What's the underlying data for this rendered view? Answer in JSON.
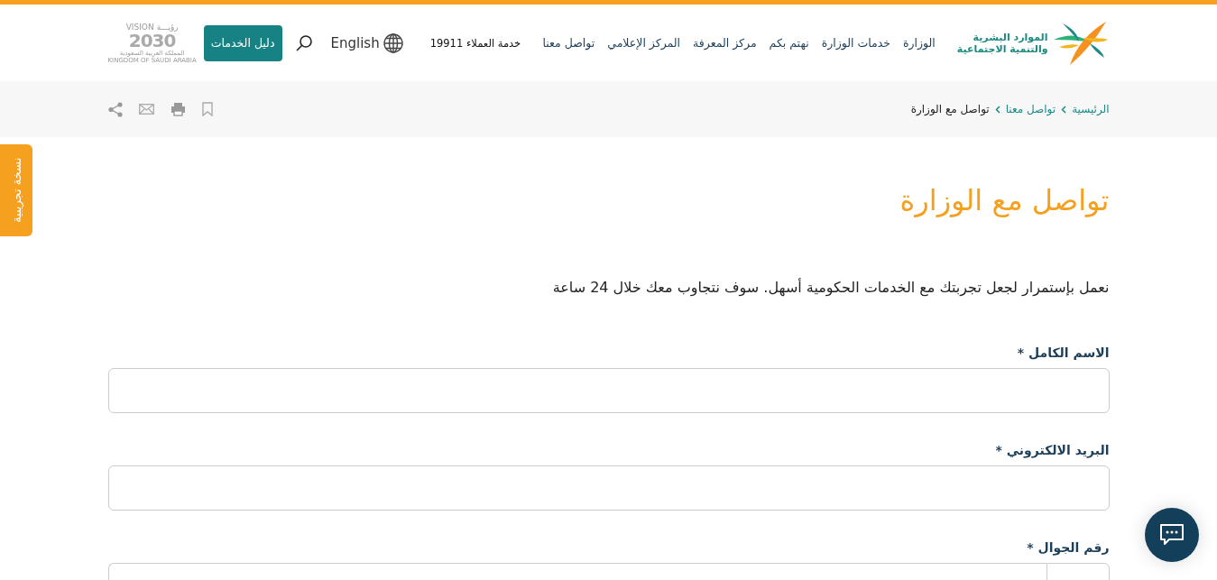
{
  "vision_logo": {
    "arabic": "رؤيـــة",
    "latin": "VISION",
    "year": "2030",
    "arabic_caption": "المملكة العربية السعودية",
    "latin_caption": "KINGDOM OF SAUDI ARABIA"
  },
  "ministry_logo": {
    "line_1": "الموارد البشرية",
    "line_2": "والتنمية الاجتماعية"
  },
  "nav": [
    "الوزارة",
    "خدمات الوزارة",
    "نهتم بكم",
    "مركز المعرفة",
    "المركز الإعلامي",
    "تواصل معنا"
  ],
  "customer_service": "خدمة العملاء 19911",
  "language": "English",
  "services_button": "دليل الخدمات",
  "breadcrumb": [
    "الرئيسية",
    "تواصل معنا",
    "تواصل مع الوزارة"
  ],
  "side_tab": "نسخة تجريبية",
  "title": "تواصل مع الوزارة",
  "intro": "نعمل بإستمرار لجعل تجربتك مع الخدمات الحكومية أسهل. سوف نتجاوب معك خلال 24 ساعة",
  "fields": [
    {
      "kind": "text",
      "label": "الاسم الكامل *"
    },
    {
      "kind": "text",
      "label": "البريد الالكتروني *"
    },
    {
      "kind": "phone",
      "label": "رقم الجوال *"
    }
  ]
}
